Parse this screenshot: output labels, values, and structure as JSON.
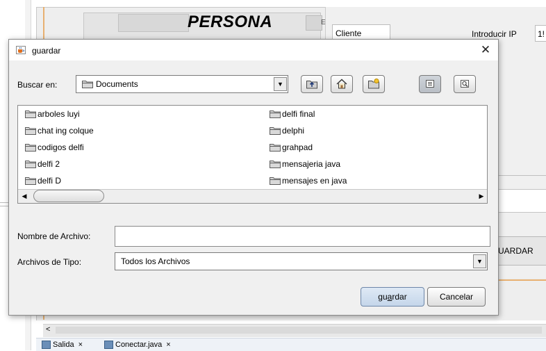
{
  "background_app": {
    "title": "PERSONA",
    "tab_marker": "E",
    "cliente_label": "Cliente",
    "intro_ip_label": "Introducir IP",
    "ip_value_fragment": "1!",
    "guardar_fragment": "UARDAR",
    "scroll_left_arrow": "<",
    "bottom_tabs": [
      {
        "label": "Salida",
        "close": "×"
      },
      {
        "label": "Conectar.java",
        "close": "×"
      }
    ]
  },
  "dialog": {
    "title": "guardar",
    "title_icon": "java-cup-icon",
    "close_glyph": "✕",
    "look_in": {
      "label": "Buscar en:",
      "value": "Documents",
      "icon": "folder-icon"
    },
    "toolbar_icons": [
      "up-one-level-icon",
      "home-icon",
      "new-folder-icon",
      "list-view-icon",
      "details-view-icon"
    ],
    "files": [
      {
        "name": "arboles luyi"
      },
      {
        "name": "chat ing colque"
      },
      {
        "name": "codigos delfi"
      },
      {
        "name": "delfi 2"
      },
      {
        "name": "delfi D"
      },
      {
        "name": "delfi final"
      },
      {
        "name": "delphi"
      },
      {
        "name": "grahpad"
      },
      {
        "name": "mensajeria java"
      },
      {
        "name": "mensajes en java"
      }
    ],
    "filename": {
      "label": "Nombre de Archivo:",
      "value": ""
    },
    "filetype": {
      "label": "Archivos de Tipo:",
      "value": "Todos los Archivos"
    },
    "buttons": {
      "save_pre": "gu",
      "save_mnemonic": "a",
      "save_post": "rdar",
      "cancel": "Cancelar"
    }
  },
  "colors": {
    "dialog_bg": "#f0f0f0",
    "accent_orange": "#e8b070",
    "save_button": "#c5d6ea",
    "folder": "#8a8a8a"
  }
}
